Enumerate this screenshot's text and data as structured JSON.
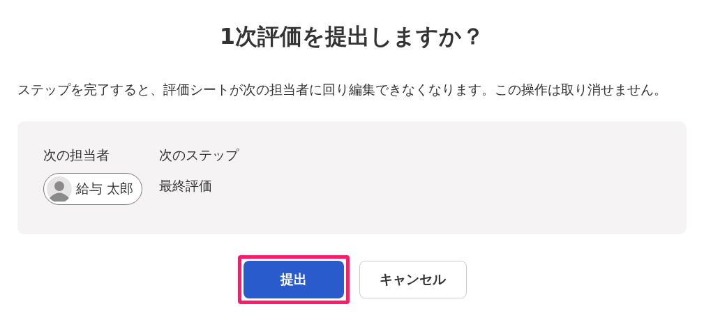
{
  "title": "1次評価を提出しますか？",
  "message": "ステップを完了すると、評価シートが次の担当者に回り編集できなくなります。この操作は取り消せません。",
  "summary": {
    "assignee": {
      "label": "次の担当者",
      "name": "給与 太郎"
    },
    "step": {
      "label": "次のステップ",
      "value": "最終評価"
    }
  },
  "buttons": [
    {
      "label": "提出",
      "kind": "primary",
      "highlighted": true
    },
    {
      "label": "キャンセル",
      "kind": "secondary",
      "highlighted": false
    }
  ]
}
